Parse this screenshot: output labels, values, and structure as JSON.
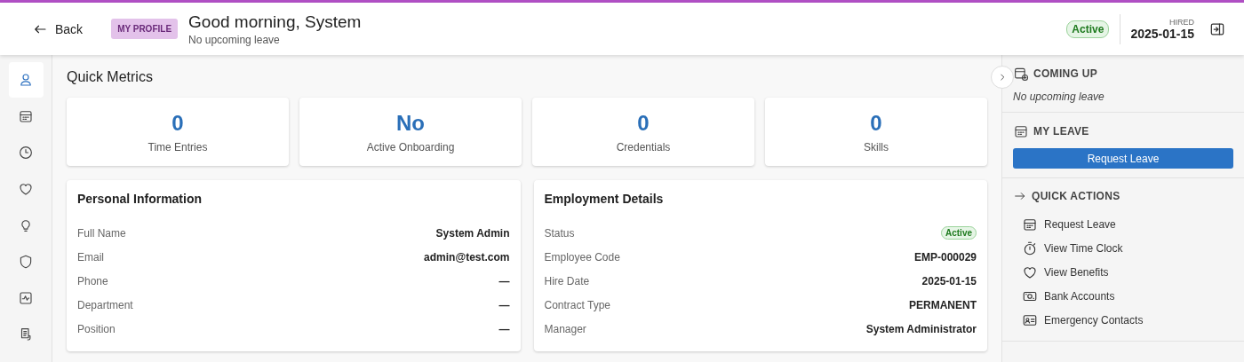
{
  "header": {
    "back_label": "Back",
    "badge": "MY PROFILE",
    "title": "Good morning, System",
    "subtitle": "No upcoming leave",
    "status": "Active",
    "hired_label": "HIRED",
    "hired_date": "2025-01-15"
  },
  "nav": [
    {
      "kind": "person",
      "selected": true
    },
    {
      "kind": "calendar",
      "selected": false
    },
    {
      "kind": "clock",
      "selected": false
    },
    {
      "kind": "heart",
      "selected": false
    },
    {
      "kind": "bulb",
      "selected": false
    },
    {
      "kind": "shield",
      "selected": false
    },
    {
      "kind": "activity",
      "selected": false
    },
    {
      "kind": "document",
      "selected": false
    }
  ],
  "metrics_title": "Quick Metrics",
  "metrics": [
    {
      "value": "0",
      "label": "Time Entries"
    },
    {
      "value": "No",
      "label": "Active Onboarding"
    },
    {
      "value": "0",
      "label": "Credentials"
    },
    {
      "value": "0",
      "label": "Skills"
    }
  ],
  "panels": [
    {
      "title": "Personal Information",
      "rows": [
        {
          "label": "Full Name",
          "value": "System Admin",
          "kind": "text"
        },
        {
          "label": "Email",
          "value": "admin@test.com",
          "kind": "text"
        },
        {
          "label": "Phone",
          "value": "—",
          "kind": "text"
        },
        {
          "label": "Department",
          "value": "—",
          "kind": "text"
        },
        {
          "label": "Position",
          "value": "—",
          "kind": "text"
        }
      ]
    },
    {
      "title": "Employment Details",
      "rows": [
        {
          "label": "Status",
          "value": "Active",
          "kind": "badge"
        },
        {
          "label": "Employee Code",
          "value": "EMP-000029",
          "kind": "text"
        },
        {
          "label": "Hire Date",
          "value": "2025-01-15",
          "kind": "text"
        },
        {
          "label": "Contract Type",
          "value": "PERMANENT",
          "kind": "text"
        },
        {
          "label": "Manager",
          "value": "System Administrator",
          "kind": "text"
        }
      ]
    }
  ],
  "coming_up": {
    "title": "COMING UP",
    "empty": "No upcoming leave"
  },
  "my_leave": {
    "title": "MY LEAVE",
    "button": "Request Leave"
  },
  "quick_actions": {
    "title": "QUICK ACTIONS",
    "items": [
      {
        "kind": "calendar",
        "label": "Request Leave"
      },
      {
        "kind": "timer",
        "label": "View Time Clock"
      },
      {
        "kind": "heart",
        "label": "View Benefits"
      },
      {
        "kind": "money",
        "label": "Bank Accounts"
      },
      {
        "kind": "idcard",
        "label": "Emergency Contacts"
      }
    ]
  }
}
